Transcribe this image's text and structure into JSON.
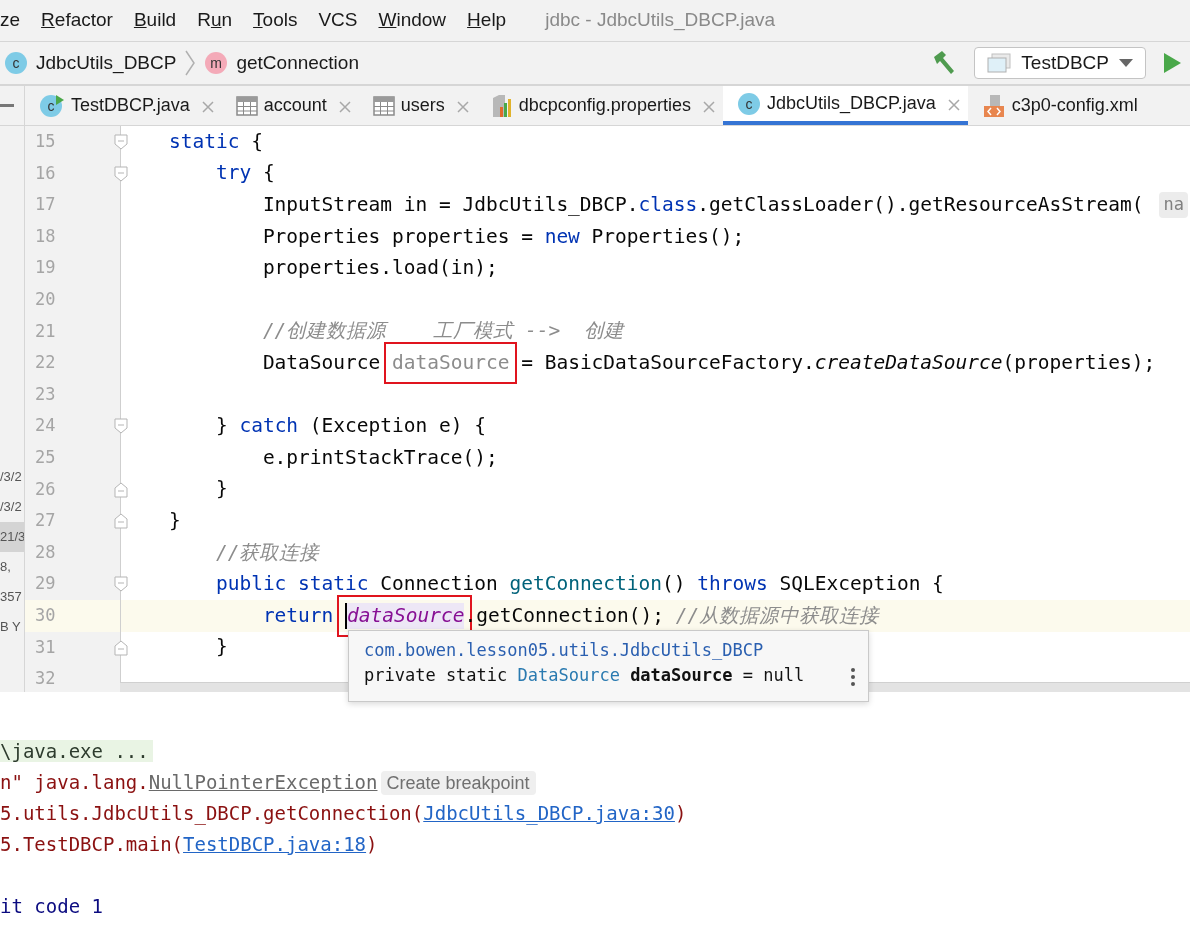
{
  "menu": [
    {
      "label": "ze"
    },
    {
      "key": "R",
      "post": "efactor"
    },
    {
      "key": "B",
      "post": "uild"
    },
    {
      "pre": "R",
      "key": "u",
      "post": "n"
    },
    {
      "key": "T",
      "post": "ools"
    },
    {
      "label": "VCS"
    },
    {
      "key": "W",
      "post": "indow"
    },
    {
      "key": "H",
      "post": "elp"
    }
  ],
  "window": {
    "title": "jdbc - JdbcUtils_DBCP.java"
  },
  "breadcrumbs": [
    {
      "kind": "class",
      "badge": "c",
      "label": "JdbcUtils_DBCP"
    },
    {
      "kind": "method",
      "badge": "m",
      "label": "getConnection"
    }
  ],
  "run_config": {
    "label": "TestDBCP"
  },
  "tabs": [
    {
      "kind": "class-run",
      "badge": "c",
      "label": "TestDBCP.java",
      "selected": false,
      "closable": true
    },
    {
      "kind": "table",
      "label": "account",
      "selected": false,
      "closable": true
    },
    {
      "kind": "table",
      "label": "users",
      "selected": false,
      "closable": true
    },
    {
      "kind": "properties",
      "label": "dbcpconfig.properties",
      "selected": false,
      "closable": true
    },
    {
      "kind": "class",
      "badge": "c",
      "label": "JdbcUtils_DBCP.java",
      "selected": true,
      "closable": true
    },
    {
      "kind": "xml",
      "label": "c3p0-config.xml",
      "selected": false,
      "closable": false
    }
  ],
  "side_panel": [
    {
      "text": "/3/2",
      "selected": false
    },
    {
      "text": "/3/2",
      "selected": false
    },
    {
      "text": "21/3",
      "selected": true
    },
    {
      "text": "8,",
      "selected": false
    },
    {
      "text": "357",
      "selected": false
    },
    {
      "text": "B Y",
      "selected": false
    }
  ],
  "code_lines": [
    {
      "number": "15",
      "kind": "fold-start",
      "current": false,
      "tokens": [
        {
          "kind": "kw",
          "text": "    static"
        },
        {
          "kind": "plain",
          "text": " {"
        }
      ]
    },
    {
      "number": "16",
      "kind": "fold-start",
      "current": false,
      "tokens": [
        {
          "kind": "kw",
          "text": "        try"
        },
        {
          "kind": "plain",
          "text": " {"
        }
      ]
    },
    {
      "number": "17",
      "current": false,
      "tokens": [
        {
          "kind": "plain",
          "text": "            InputStream in = JdbcUtils_DBCP."
        },
        {
          "kind": "kw",
          "text": "class"
        },
        {
          "kind": "plain",
          "text": ".getClassLoader().getResourceAsStream("
        },
        {
          "kind": "hint",
          "text": "na"
        }
      ]
    },
    {
      "number": "18",
      "current": false,
      "tokens": [
        {
          "kind": "plain",
          "text": "            Properties properties = "
        },
        {
          "kind": "kw",
          "text": "new"
        },
        {
          "kind": "plain",
          "text": " Properties();"
        }
      ]
    },
    {
      "number": "19",
      "current": false,
      "tokens": [
        {
          "kind": "plain",
          "text": "            properties.load(in);"
        }
      ]
    },
    {
      "number": "20",
      "current": false
    },
    {
      "number": "21",
      "current": false,
      "tokens": [
        {
          "kind": "comment",
          "text": "            //创建数据源    工厂模式 -->  创建"
        }
      ]
    },
    {
      "number": "22",
      "current": false,
      "tokens": [
        {
          "kind": "plain",
          "text": "            DataSource "
        },
        {
          "kind": "unused",
          "text": "dataSource",
          "boxed": true
        },
        {
          "kind": "plain",
          "text": " = BasicDataSourceFactory."
        },
        {
          "kind": "italic",
          "text": "createDataSource"
        },
        {
          "kind": "plain",
          "text": "(properties);"
        }
      ]
    },
    {
      "number": "23",
      "current": false
    },
    {
      "number": "24",
      "kind": "fold-start",
      "current": false,
      "tokens": [
        {
          "kind": "plain",
          "text": "        } "
        },
        {
          "kind": "kw",
          "text": "catch"
        },
        {
          "kind": "plain",
          "text": " (Exception e) {"
        }
      ]
    },
    {
      "number": "25",
      "current": false,
      "tokens": [
        {
          "kind": "plain",
          "text": "            e.printStackTrace();"
        }
      ]
    },
    {
      "number": "26",
      "kind": "fold-end",
      "current": false,
      "tokens": [
        {
          "kind": "plain",
          "text": "        }"
        }
      ]
    },
    {
      "number": "27",
      "kind": "fold-end",
      "current": false,
      "tokens": [
        {
          "kind": "plain",
          "text": "    }"
        }
      ]
    },
    {
      "number": "28",
      "current": false,
      "tokens": [
        {
          "kind": "comment",
          "text": "        //获取连接"
        }
      ]
    },
    {
      "number": "29",
      "kind": "fold-start",
      "current": false,
      "tokens": [
        {
          "kind": "kw",
          "text": "        public static"
        },
        {
          "kind": "plain",
          "text": " Connection "
        },
        {
          "kind": "decl",
          "text": "getConnection"
        },
        {
          "kind": "plain",
          "text": "() "
        },
        {
          "kind": "kw",
          "text": "throws"
        },
        {
          "kind": "plain",
          "text": " SQLException {"
        }
      ]
    },
    {
      "number": "30",
      "current": true,
      "tokens": [
        {
          "kind": "kw",
          "text": "            return "
        },
        {
          "kind": "field",
          "text": "dataSource",
          "boxed": true,
          "caret": true
        },
        {
          "kind": "plain",
          "text": ".getConnection(); "
        },
        {
          "kind": "comment",
          "text": "//从数据源中获取连接"
        }
      ]
    },
    {
      "number": "31",
      "kind": "fold-end",
      "current": false,
      "tokens": [
        {
          "kind": "plain",
          "text": "        }"
        }
      ]
    },
    {
      "number": "32",
      "current": false
    }
  ],
  "tooltip": {
    "location": "com.bowen.lesson05.utils.JdbcUtils_DBCP",
    "signature": [
      {
        "kind": "plain",
        "text": "private static "
      },
      {
        "kind": "type",
        "text": "DataSource "
      },
      {
        "kind": "bold",
        "text": "dataSource"
      },
      {
        "kind": "plain",
        "text": " = null"
      }
    ]
  },
  "console": [
    {
      "kind": "cmd",
      "tokens": [
        {
          "kind": "cmd",
          "text": "\\java.exe ..."
        }
      ]
    },
    {
      "kind": "error",
      "tokens": [
        {
          "kind": "err",
          "text": "n\" java.lang."
        },
        {
          "kind": "exlink",
          "text": "NullPointerException"
        }
      ],
      "chip": "Create breakpoint"
    },
    {
      "kind": "error",
      "tokens": [
        {
          "kind": "err",
          "text": "5.utils.JdbcUtils_DBCP.getConnection("
        },
        {
          "kind": "link",
          "text": "JdbcUtils_DBCP.java:30"
        },
        {
          "kind": "err",
          "text": ")"
        }
      ]
    },
    {
      "kind": "error",
      "tokens": [
        {
          "kind": "err",
          "text": "5.TestDBCP.main("
        },
        {
          "kind": "link",
          "text": "TestDBCP.java:18"
        },
        {
          "kind": "err",
          "text": ")"
        }
      ]
    },
    {
      "kind": "exit",
      "tokens": [
        {
          "kind": "exit",
          "text": "it code 1"
        }
      ]
    }
  ]
}
